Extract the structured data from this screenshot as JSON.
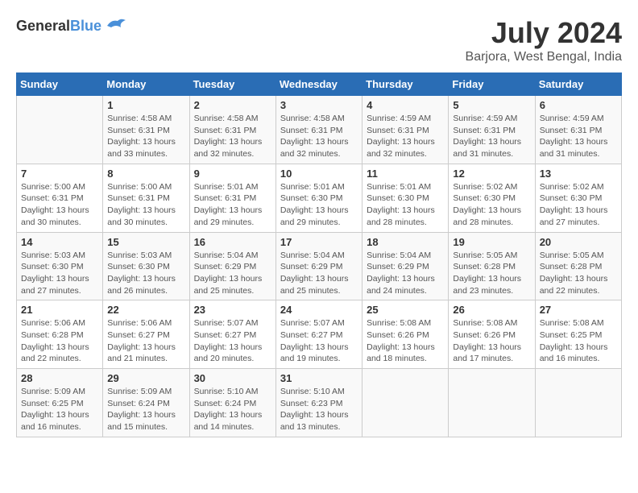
{
  "header": {
    "logo_general": "General",
    "logo_blue": "Blue",
    "title": "July 2024",
    "location": "Barjora, West Bengal, India"
  },
  "calendar": {
    "days_of_week": [
      "Sunday",
      "Monday",
      "Tuesday",
      "Wednesday",
      "Thursday",
      "Friday",
      "Saturday"
    ],
    "weeks": [
      [
        {
          "day": "",
          "detail": ""
        },
        {
          "day": "1",
          "detail": "Sunrise: 4:58 AM\nSunset: 6:31 PM\nDaylight: 13 hours\nand 33 minutes."
        },
        {
          "day": "2",
          "detail": "Sunrise: 4:58 AM\nSunset: 6:31 PM\nDaylight: 13 hours\nand 32 minutes."
        },
        {
          "day": "3",
          "detail": "Sunrise: 4:58 AM\nSunset: 6:31 PM\nDaylight: 13 hours\nand 32 minutes."
        },
        {
          "day": "4",
          "detail": "Sunrise: 4:59 AM\nSunset: 6:31 PM\nDaylight: 13 hours\nand 32 minutes."
        },
        {
          "day": "5",
          "detail": "Sunrise: 4:59 AM\nSunset: 6:31 PM\nDaylight: 13 hours\nand 31 minutes."
        },
        {
          "day": "6",
          "detail": "Sunrise: 4:59 AM\nSunset: 6:31 PM\nDaylight: 13 hours\nand 31 minutes."
        }
      ],
      [
        {
          "day": "7",
          "detail": "Sunrise: 5:00 AM\nSunset: 6:31 PM\nDaylight: 13 hours\nand 30 minutes."
        },
        {
          "day": "8",
          "detail": "Sunrise: 5:00 AM\nSunset: 6:31 PM\nDaylight: 13 hours\nand 30 minutes."
        },
        {
          "day": "9",
          "detail": "Sunrise: 5:01 AM\nSunset: 6:31 PM\nDaylight: 13 hours\nand 29 minutes."
        },
        {
          "day": "10",
          "detail": "Sunrise: 5:01 AM\nSunset: 6:30 PM\nDaylight: 13 hours\nand 29 minutes."
        },
        {
          "day": "11",
          "detail": "Sunrise: 5:01 AM\nSunset: 6:30 PM\nDaylight: 13 hours\nand 28 minutes."
        },
        {
          "day": "12",
          "detail": "Sunrise: 5:02 AM\nSunset: 6:30 PM\nDaylight: 13 hours\nand 28 minutes."
        },
        {
          "day": "13",
          "detail": "Sunrise: 5:02 AM\nSunset: 6:30 PM\nDaylight: 13 hours\nand 27 minutes."
        }
      ],
      [
        {
          "day": "14",
          "detail": "Sunrise: 5:03 AM\nSunset: 6:30 PM\nDaylight: 13 hours\nand 27 minutes."
        },
        {
          "day": "15",
          "detail": "Sunrise: 5:03 AM\nSunset: 6:30 PM\nDaylight: 13 hours\nand 26 minutes."
        },
        {
          "day": "16",
          "detail": "Sunrise: 5:04 AM\nSunset: 6:29 PM\nDaylight: 13 hours\nand 25 minutes."
        },
        {
          "day": "17",
          "detail": "Sunrise: 5:04 AM\nSunset: 6:29 PM\nDaylight: 13 hours\nand 25 minutes."
        },
        {
          "day": "18",
          "detail": "Sunrise: 5:04 AM\nSunset: 6:29 PM\nDaylight: 13 hours\nand 24 minutes."
        },
        {
          "day": "19",
          "detail": "Sunrise: 5:05 AM\nSunset: 6:28 PM\nDaylight: 13 hours\nand 23 minutes."
        },
        {
          "day": "20",
          "detail": "Sunrise: 5:05 AM\nSunset: 6:28 PM\nDaylight: 13 hours\nand 22 minutes."
        }
      ],
      [
        {
          "day": "21",
          "detail": "Sunrise: 5:06 AM\nSunset: 6:28 PM\nDaylight: 13 hours\nand 22 minutes."
        },
        {
          "day": "22",
          "detail": "Sunrise: 5:06 AM\nSunset: 6:27 PM\nDaylight: 13 hours\nand 21 minutes."
        },
        {
          "day": "23",
          "detail": "Sunrise: 5:07 AM\nSunset: 6:27 PM\nDaylight: 13 hours\nand 20 minutes."
        },
        {
          "day": "24",
          "detail": "Sunrise: 5:07 AM\nSunset: 6:27 PM\nDaylight: 13 hours\nand 19 minutes."
        },
        {
          "day": "25",
          "detail": "Sunrise: 5:08 AM\nSunset: 6:26 PM\nDaylight: 13 hours\nand 18 minutes."
        },
        {
          "day": "26",
          "detail": "Sunrise: 5:08 AM\nSunset: 6:26 PM\nDaylight: 13 hours\nand 17 minutes."
        },
        {
          "day": "27",
          "detail": "Sunrise: 5:08 AM\nSunset: 6:25 PM\nDaylight: 13 hours\nand 16 minutes."
        }
      ],
      [
        {
          "day": "28",
          "detail": "Sunrise: 5:09 AM\nSunset: 6:25 PM\nDaylight: 13 hours\nand 16 minutes."
        },
        {
          "day": "29",
          "detail": "Sunrise: 5:09 AM\nSunset: 6:24 PM\nDaylight: 13 hours\nand 15 minutes."
        },
        {
          "day": "30",
          "detail": "Sunrise: 5:10 AM\nSunset: 6:24 PM\nDaylight: 13 hours\nand 14 minutes."
        },
        {
          "day": "31",
          "detail": "Sunrise: 5:10 AM\nSunset: 6:23 PM\nDaylight: 13 hours\nand 13 minutes."
        },
        {
          "day": "",
          "detail": ""
        },
        {
          "day": "",
          "detail": ""
        },
        {
          "day": "",
          "detail": ""
        }
      ]
    ]
  }
}
